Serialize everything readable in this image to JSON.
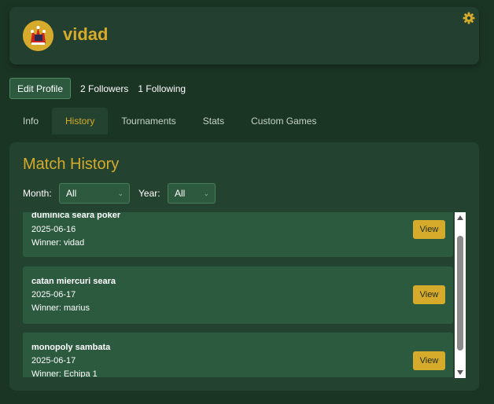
{
  "profile": {
    "username": "vidad",
    "edit_label": "Edit Profile",
    "followers": "2 Followers",
    "following": "1 Following"
  },
  "tabs": [
    {
      "label": "Info"
    },
    {
      "label": "History"
    },
    {
      "label": "Tournaments"
    },
    {
      "label": "Stats"
    },
    {
      "label": "Custom Games"
    }
  ],
  "history": {
    "title": "Match History",
    "month_label": "Month:",
    "month_value": "All",
    "year_label": "Year:",
    "year_value": "All",
    "view_label": "View",
    "matches": [
      {
        "name": "duminica seara poker",
        "date": "2025-06-16",
        "winner": "Winner: vidad"
      },
      {
        "name": "catan miercuri seara",
        "date": "2025-06-17",
        "winner": "Winner: marius"
      },
      {
        "name": "monopoly sambata",
        "date": "2025-06-17",
        "winner": "Winner: Echipa 1"
      }
    ]
  },
  "colors": {
    "accent": "#d6ab2c",
    "background": "#1b3525",
    "card": "#23422f"
  },
  "icons": {
    "settings": "gear-icon",
    "avatar": "jester-avatar"
  },
  "scroll_position": 0.1
}
